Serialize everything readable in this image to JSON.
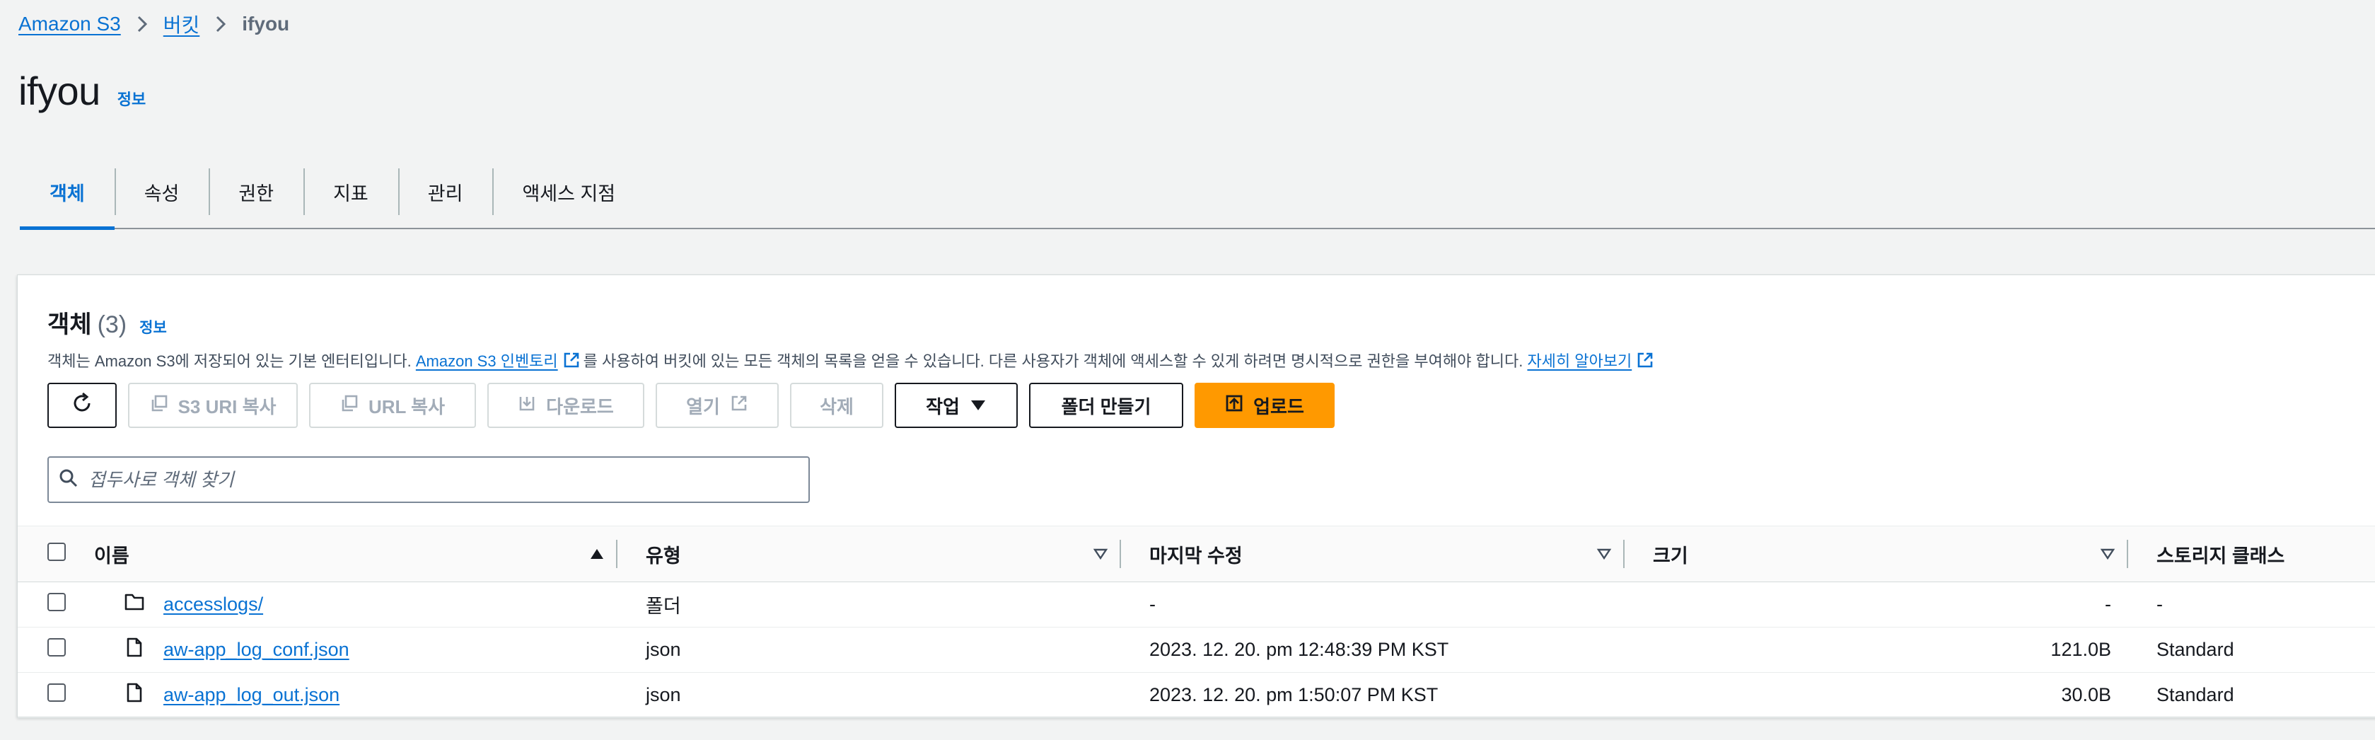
{
  "breadcrumb": {
    "root": "Amazon S3",
    "buckets": "버킷",
    "current": "ifyou"
  },
  "page": {
    "title": "ifyou",
    "info": "정보"
  },
  "tabs": [
    {
      "label": "객체",
      "active": true
    },
    {
      "label": "속성"
    },
    {
      "label": "권한"
    },
    {
      "label": "지표"
    },
    {
      "label": "관리"
    },
    {
      "label": "액세스 지점"
    }
  ],
  "objects": {
    "title": "객체",
    "count": "(3)",
    "info": "정보",
    "desc_before": "객체는 Amazon S3에 저장되어 있는 기본 엔터티입니다.",
    "desc_link": "Amazon S3 인벤토리",
    "desc_after": "를 사용하여 버킷에 있는 모든 객체의 목록을 얻을 수 있습니다. 다른 사용자가 객체에 액세스할 수 있게 하려면 명시적으로 권한을 부여해야 합니다.",
    "learn_more": "자세히 알아보기"
  },
  "actions": {
    "s3_uri_copy": "S3 URI 복사",
    "url_copy": "URL 복사",
    "download": "다운로드",
    "open": "열기",
    "delete": "삭제",
    "actions": "작업",
    "create_folder": "폴더 만들기",
    "upload": "업로드"
  },
  "search": {
    "placeholder": "접두사로 객체 찾기"
  },
  "table": {
    "columns": {
      "name": "이름",
      "type": "유형",
      "modified": "마지막 수정",
      "size": "크기",
      "storage": "스토리지 클래스"
    },
    "rows": [
      {
        "name": "accesslogs/",
        "type": "폴더",
        "modified": "-",
        "size": "-",
        "storage": "-",
        "kind": "folder"
      },
      {
        "name": "aw-app_log_conf.json",
        "type": "json",
        "modified": "2023. 12. 20. pm 12:48:39 PM KST",
        "size": "121.0B",
        "storage": "Standard",
        "kind": "file"
      },
      {
        "name": "aw-app_log_out.json",
        "type": "json",
        "modified": "2023. 12. 20. pm 1:50:07 PM KST",
        "size": "30.0B",
        "storage": "Standard",
        "kind": "file"
      }
    ]
  },
  "colors": {
    "link": "#0972d3",
    "primary": "#ff9900",
    "background": "#f2f3f3"
  }
}
